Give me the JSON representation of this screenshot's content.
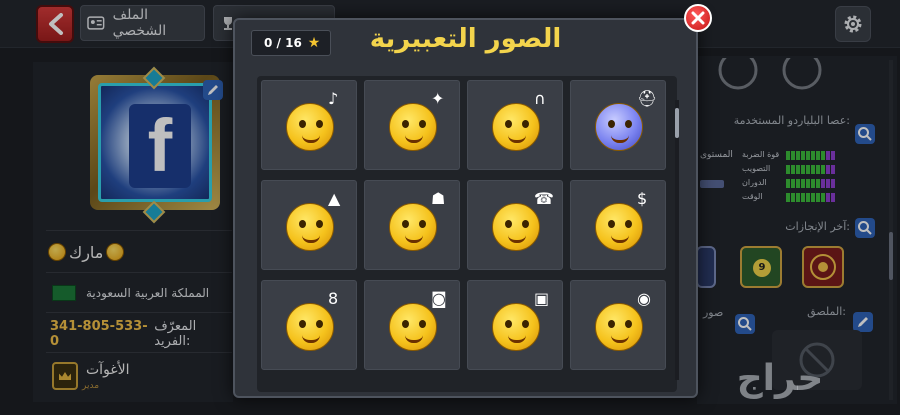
{
  "topbar": {
    "profile_tab_label": "الملف الشخصي",
    "trophy_tab_label": "",
    "icons": {
      "back": "back-arrow-icon",
      "profile": "profile-card-icon",
      "trophy": "trophy-icon",
      "settings": "gear-icon"
    }
  },
  "profile": {
    "avatar": "facebook-avatar",
    "name": "مارك",
    "country": "المملكة العربية السعودية",
    "unique_id_label": "المعرّف الفريد:",
    "unique_id_value": "341-805-533-0",
    "club_name": "الأغوآت",
    "club_role": "مدير",
    "colors": {
      "uid": "#f2c14a",
      "club_role": "#b78f3e"
    }
  },
  "right_panel": {
    "cue_title": "عصا البلياردو المستخدمة:",
    "level_label": "المستوى",
    "stats": [
      {
        "label": "قوة الضربة",
        "on": 8,
        "total": 10
      },
      {
        "label": "التصويب",
        "on": 8,
        "total": 10
      },
      {
        "label": "الدوران",
        "on": 7,
        "total": 10
      },
      {
        "label": "الوقت",
        "on": 8,
        "total": 10
      }
    ],
    "achievements_title": "آخر الإنجازات:",
    "sticker_label": "الملصق:",
    "photo_label": "صور",
    "achievement_badges": [
      "9",
      "9",
      "target"
    ]
  },
  "modal": {
    "title": "الصور التعبيرية",
    "counter_value": "0 / 16",
    "counter_icon": "star-icon",
    "close_icon": "close-icon",
    "emojis": [
      {
        "name": "cool-singing-emoji",
        "accent": "♪",
        "style": "yellow"
      },
      {
        "name": "genie-emoji",
        "accent": "✦",
        "style": "yellow"
      },
      {
        "name": "headphones-emoji",
        "accent": "∩",
        "style": "yellow"
      },
      {
        "name": "viking-frozen-emoji",
        "accent": "⛑",
        "style": "blue"
      },
      {
        "name": "detective-hat-emoji",
        "accent": "▲",
        "style": "yellow"
      },
      {
        "name": "wizard-scroll-emoji",
        "accent": "☗",
        "style": "yellow"
      },
      {
        "name": "telephone-emoji",
        "accent": "☎",
        "style": "yellow"
      },
      {
        "name": "money-bag-emoji",
        "accent": "$",
        "style": "yellow"
      },
      {
        "name": "eight-ball-emoji",
        "accent": "8",
        "style": "yellow"
      },
      {
        "name": "camera-emoji",
        "accent": "◙",
        "style": "yellow"
      },
      {
        "name": "briefcase-emoji",
        "accent": "▣",
        "style": "yellow"
      },
      {
        "name": "cowboy-emoji",
        "accent": "◉",
        "style": "yellow"
      }
    ]
  },
  "watermark": "حراج"
}
